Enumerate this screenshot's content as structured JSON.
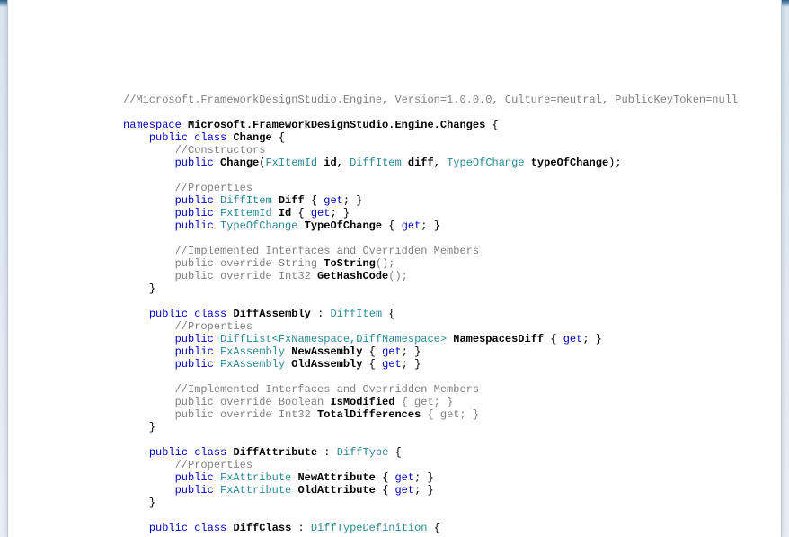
{
  "header_comment": "//Microsoft.FrameworkDesignStudio.Engine, Version=1.0.0.0, Culture=neutral, PublicKeyToken=null",
  "kw": {
    "namespace": "namespace",
    "public": "public",
    "class": "class",
    "get": "get"
  },
  "ns_name": "Microsoft.FrameworkDesignStudio.Engine.Changes",
  "classes": {
    "change": {
      "name": "Change",
      "ctor_comment": "//Constructors",
      "ctor_params": {
        "p1_type": "FxItemId",
        "p1_name": "id",
        "p2_type": "DiffItem",
        "p2_name": "diff",
        "p3_type": "TypeOfChange",
        "p3_name": "typeOfChange"
      },
      "prop_comment": "//Properties",
      "props": {
        "diff_type": "DiffItem",
        "diff_name": "Diff",
        "id_type": "FxItemId",
        "id_name": "Id",
        "toc_type": "TypeOfChange",
        "toc_name": "TypeOfChange"
      },
      "impl_comment": "//Implemented Interfaces and Overridden Members",
      "overrides": {
        "tostr_sig": "public override String ",
        "tostr_name": "ToString",
        "tostr_tail": "();",
        "hash_sig": "public override Int32 ",
        "hash_name": "GetHashCode",
        "hash_tail": "();"
      }
    },
    "diffassembly": {
      "name": "DiffAssembly",
      "base": "DiffItem",
      "prop_comment": "//Properties",
      "props": {
        "nsdiff_type": "DiffList<FxNamespace,DiffNamespace>",
        "nsdiff_name": "NamespacesDiff",
        "newasm_type": "FxAssembly",
        "newasm_name": "NewAssembly",
        "oldasm_type": "FxAssembly",
        "oldasm_name": "OldAssembly"
      },
      "impl_comment": "//Implemented Interfaces and Overridden Members",
      "overrides": {
        "ismod_sig": "public override Boolean ",
        "ismod_name": "IsModified",
        "ismod_tail": " { get; }",
        "tdiff_sig": "public override Int32 ",
        "tdiff_name": "TotalDifferences",
        "tdiff_tail": " { get; }"
      }
    },
    "diffattribute": {
      "name": "DiffAttribute",
      "base": "DiffType",
      "prop_comment": "//Properties",
      "props": {
        "newattr_type": "FxAttribute",
        "newattr_name": "NewAttribute",
        "oldattr_type": "FxAttribute",
        "oldattr_name": "OldAttribute"
      }
    },
    "diffclass": {
      "name": "DiffClass",
      "base": "DiffTypeDefinition"
    }
  }
}
